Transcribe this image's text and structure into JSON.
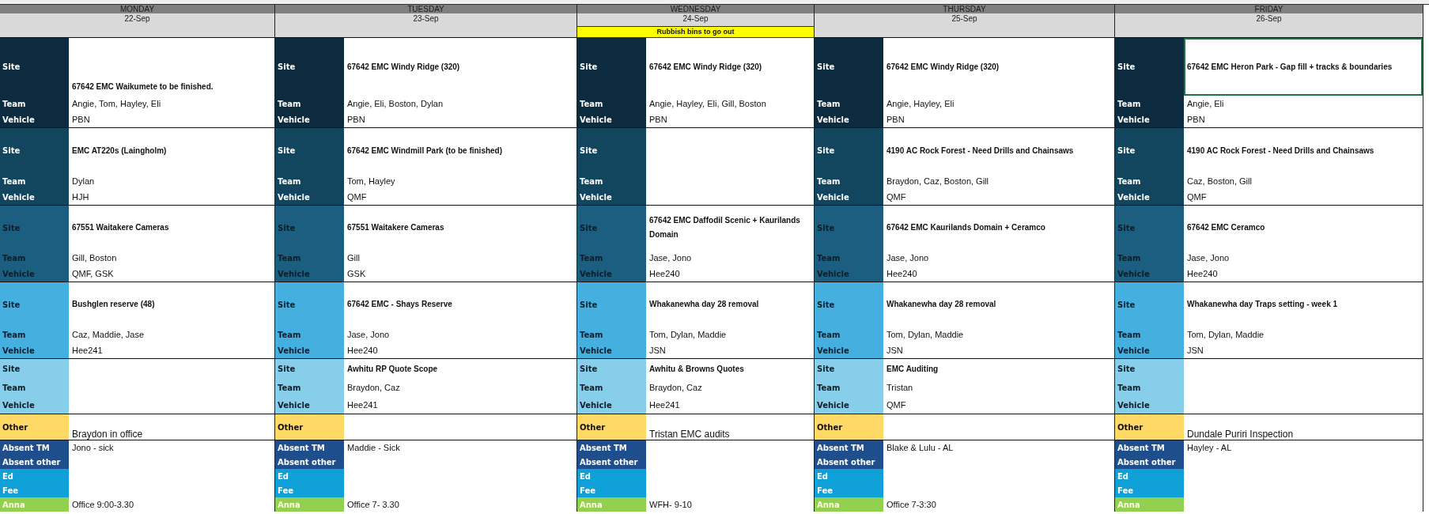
{
  "days": [
    {
      "name": "MONDAY",
      "date": "22-Sep",
      "blocks": [
        {
          "site_label": "Site",
          "site": "67642 EMC Waikumete to be finished.",
          "team_label": "Team",
          "team": "Angie, Tom, Hayley, Eli",
          "vehicle_label": "Vehicle",
          "vehicle": "PBN",
          "selected": false
        },
        {
          "site_label": "Site",
          "site": "EMC AT220s (Laingholm)",
          "team_label": "Team",
          "team": "Dylan",
          "vehicle_label": "Vehicle",
          "vehicle": "HJH",
          "selected": false
        },
        {
          "site_label": "Site",
          "site": "67551 Waitakere Cameras",
          "team_label": "Team",
          "team": "Gill, Boston",
          "vehicle_label": "Vehicle",
          "vehicle": "QMF, GSK",
          "selected": false
        },
        {
          "site_label": "Site",
          "site": "Bushglen reserve (48)",
          "team_label": "Team",
          "team": "Caz, Maddie, Jase",
          "vehicle_label": "Vehicle",
          "vehicle": "Hee241",
          "selected": false
        },
        {
          "site_label": "Site",
          "team_label": "Team",
          "vehicle_label": "Vehicle",
          "selected": false
        }
      ],
      "other": {
        "label": "Other",
        "value": "Braydon in office"
      },
      "absent": [
        {
          "label": "Absent TM",
          "value": "Jono - sick"
        },
        {
          "label": "Absent other"
        },
        {
          "label": "Ed"
        },
        {
          "label": "Fee"
        },
        {
          "label": "Anna",
          "value": "Office 9:00-3.30"
        }
      ]
    },
    {
      "name": "TUESDAY",
      "date": "23-Sep",
      "blocks": [
        {
          "site_label": "Site",
          "site": "67642 EMC Windy Ridge (320)",
          "team_label": "Team",
          "team": "Angie, Eli, Boston, Dylan",
          "vehicle_label": "Vehicle",
          "vehicle": "PBN",
          "selected": false
        },
        {
          "site_label": "Site",
          "site": "67642 EMC Windmill Park (to be finished)",
          "team_label": "Team",
          "team": "Tom, Hayley",
          "vehicle_label": "Vehicle",
          "vehicle": "QMF",
          "selected": false
        },
        {
          "site_label": "Site",
          "site": "67551 Waitakere Cameras",
          "team_label": "Team",
          "team": "Gill",
          "vehicle_label": "Vehicle",
          "vehicle": "GSK",
          "selected": false
        },
        {
          "site_label": "Site",
          "site": "67642 EMC - Shays Reserve",
          "team_label": "Team",
          "team": "Jase, Jono",
          "vehicle_label": "Vehicle",
          "vehicle": "Hee240",
          "selected": false
        },
        {
          "site_label": "Site",
          "site": "Awhitu RP Quote Scope",
          "team_label": "Team",
          "team": "Braydon, Caz",
          "vehicle_label": "Vehicle",
          "vehicle": "Hee241",
          "selected": false
        }
      ],
      "other": {
        "label": "Other"
      },
      "absent": [
        {
          "label": "Absent TM",
          "value": "Maddie - Sick"
        },
        {
          "label": "Absent other"
        },
        {
          "label": "Ed"
        },
        {
          "label": "Fee"
        },
        {
          "label": "Anna",
          "value": "Office 7- 3.30"
        }
      ]
    },
    {
      "name": "WEDNESDAY",
      "date": "24-Sep",
      "note": "Rubbish bins to go out",
      "blocks": [
        {
          "site_label": "Site",
          "site": "67642 EMC Windy Ridge (320)",
          "team_label": "Team",
          "team": "Angie, Hayley, Eli, Gill, Boston",
          "vehicle_label": "Vehicle",
          "vehicle": "PBN",
          "selected": false
        },
        {
          "site_label": "Site",
          "team_label": "Team",
          "vehicle_label": "Vehicle",
          "selected": false
        },
        {
          "site_label": "Site",
          "site": "67642 EMC Daffodil Scenic + Kaurilands Domain",
          "team_label": "Team",
          "team": "Jase, Jono",
          "vehicle_label": "Vehicle",
          "vehicle": "Hee240",
          "selected": false
        },
        {
          "site_label": "Site",
          "site": "Whakanewha day 28 removal",
          "team_label": "Team",
          "team": "Tom, Dylan, Maddie",
          "vehicle_label": "Vehicle",
          "vehicle": "JSN",
          "selected": false
        },
        {
          "site_label": "Site",
          "site": "Awhitu & Browns Quotes",
          "team_label": "Team",
          "team": "Braydon, Caz",
          "vehicle_label": "Vehicle",
          "vehicle": "Hee241",
          "selected": false
        }
      ],
      "other": {
        "label": "Other",
        "value": "Tristan EMC audits"
      },
      "absent": [
        {
          "label": "Absent TM"
        },
        {
          "label": "Absent other"
        },
        {
          "label": "Ed"
        },
        {
          "label": "Fee"
        },
        {
          "label": "Anna",
          "value": "WFH- 9-10"
        }
      ]
    },
    {
      "name": "THURSDAY",
      "date": "25-Sep",
      "blocks": [
        {
          "site_label": "Site",
          "site": "67642 EMC Windy Ridge (320)",
          "team_label": "Team",
          "team": "Angie, Hayley, Eli",
          "vehicle_label": "Vehicle",
          "vehicle": "PBN",
          "selected": false
        },
        {
          "site_label": "Site",
          "site": "4190 AC Rock Forest - Need Drills and Chainsaws",
          "team_label": "Team",
          "team": "Braydon, Caz, Boston, Gill",
          "vehicle_label": "Vehicle",
          "vehicle": "QMF",
          "selected": false
        },
        {
          "site_label": "Site",
          "site": "67642 EMC Kaurilands Domain + Ceramco",
          "team_label": "Team",
          "team": "Jase, Jono",
          "vehicle_label": "Vehicle",
          "vehicle": "Hee240",
          "selected": false
        },
        {
          "site_label": "Site",
          "site": "Whakanewha day 28 removal",
          "team_label": "Team",
          "team": "Tom, Dylan, Maddie",
          "vehicle_label": "Vehicle",
          "vehicle": "JSN",
          "selected": false
        },
        {
          "site_label": "Site",
          "site": "EMC Auditing",
          "team_label": "Team",
          "team": "Tristan",
          "vehicle_label": "Vehicle",
          "vehicle": "QMF",
          "selected": false
        }
      ],
      "other": {
        "label": "Other"
      },
      "absent": [
        {
          "label": "Absent TM",
          "value": "Blake & Lulu - AL"
        },
        {
          "label": "Absent other"
        },
        {
          "label": "Ed"
        },
        {
          "label": "Fee"
        },
        {
          "label": "Anna",
          "value": "Office 7-3:30"
        }
      ]
    },
    {
      "name": "FRIDAY",
      "date": "26-Sep",
      "blocks": [
        {
          "site_label": "Site",
          "site": "67642 EMC Heron Park - Gap fill + tracks & boundaries",
          "team_label": "Team",
          "team": "Angie, Eli",
          "vehicle_label": "Vehicle",
          "vehicle": "PBN",
          "selected": true
        },
        {
          "site_label": "Site",
          "site": "4190 AC Rock Forest - Need Drills and Chainsaws",
          "team_label": "Team",
          "team": "Caz, Boston, Gill",
          "vehicle_label": "Vehicle",
          "vehicle": "QMF",
          "selected": false
        },
        {
          "site_label": "Site",
          "site": "67642 EMC Ceramco",
          "team_label": "Team",
          "team": "Jase, Jono",
          "vehicle_label": "Vehicle",
          "vehicle": "Hee240",
          "selected": false
        },
        {
          "site_label": "Site",
          "site": "Whakanewha day Traps setting - week 1",
          "team_label": "Team",
          "team": "Tom, Dylan, Maddie",
          "vehicle_label": "Vehicle",
          "vehicle": "JSN",
          "selected": false
        },
        {
          "site_label": "Site",
          "team_label": "Team",
          "vehicle_label": "Vehicle",
          "selected": false
        }
      ],
      "other": {
        "label": "Other",
        "value": "Dundale Puriri Inspection"
      },
      "absent": [
        {
          "label": "Absent TM",
          "value": "Hayley - AL"
        },
        {
          "label": "Absent other"
        },
        {
          "label": "Ed"
        },
        {
          "label": "Fee"
        },
        {
          "label": "Anna"
        }
      ]
    }
  ]
}
